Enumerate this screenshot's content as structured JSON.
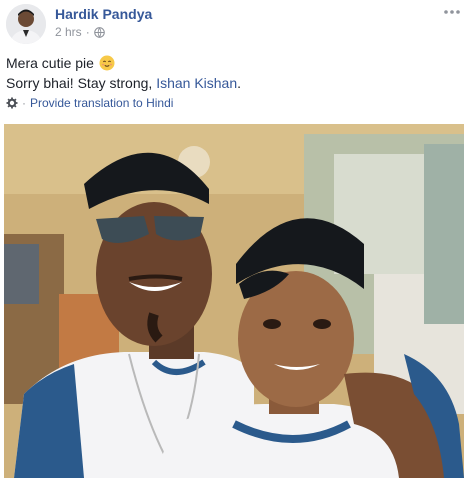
{
  "post": {
    "author": "Hardik Pandya",
    "timestamp": "2 hrs",
    "separator": "·",
    "privacy_icon": "globe-icon",
    "more_icon": "ellipsis-icon",
    "text_line1": "Mera cutie pie",
    "text_line1_emoji": "smiling-face-emoji",
    "text_line2_prefix": "Sorry bhai! Stay strong, ",
    "text_line2_mention": "Ishan Kishan",
    "text_line2_suffix": ".",
    "translate_icon": "gear-icon",
    "translate_separator": "·",
    "translate_label": "Provide translation to Hindi"
  },
  "colors": {
    "link": "#365899",
    "meta": "#90949c",
    "text": "#1d2129"
  }
}
